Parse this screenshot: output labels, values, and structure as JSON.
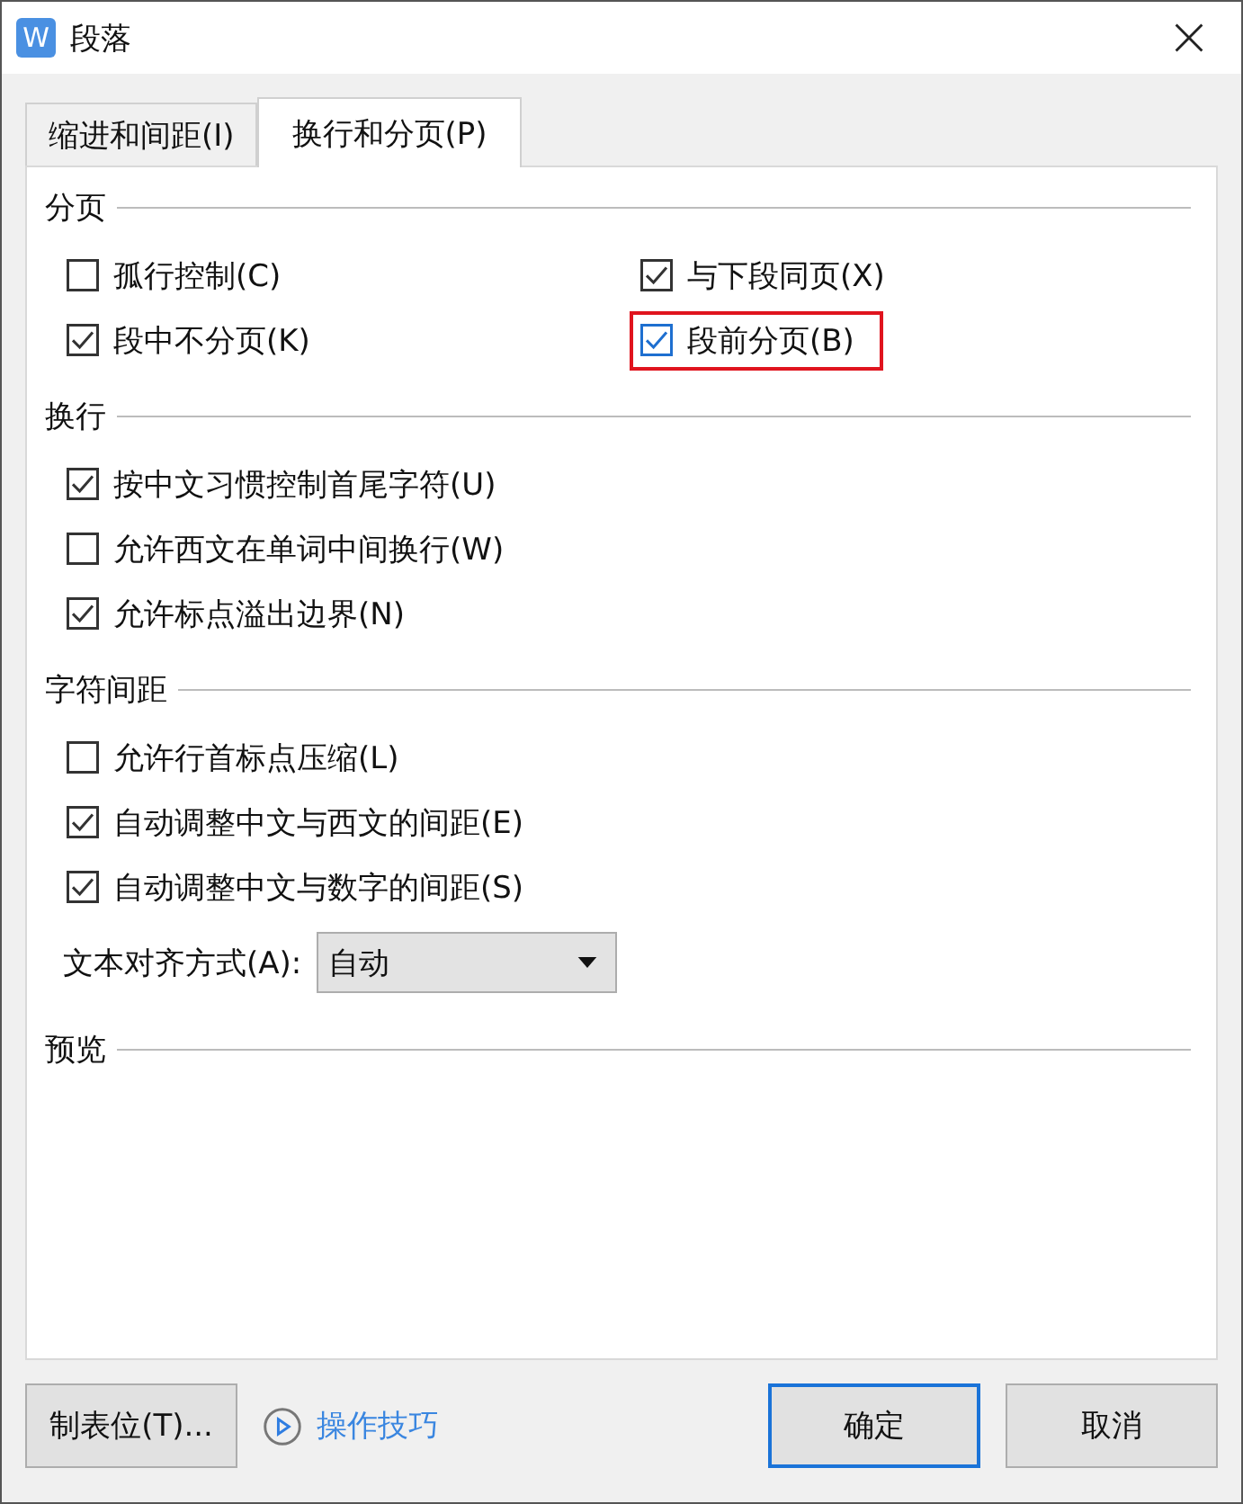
{
  "window": {
    "icon_letter": "W",
    "title": "段落"
  },
  "tabs": [
    {
      "label": "缩进和间距(I)",
      "selected": false
    },
    {
      "label": "换行和分页(P)",
      "selected": true
    }
  ],
  "sections": [
    {
      "title": "分页",
      "kind": "two-column",
      "items": [
        {
          "kind": "checkbox",
          "label": "孤行控制(C)",
          "checked": false,
          "focused": false,
          "highlighted": false
        },
        {
          "kind": "checkbox",
          "label": "与下段同页(X)",
          "checked": true,
          "focused": false,
          "highlighted": false
        },
        {
          "kind": "checkbox",
          "label": "段中不分页(K)",
          "checked": true,
          "focused": false,
          "highlighted": false
        },
        {
          "kind": "checkbox",
          "label": "段前分页(B)",
          "checked": true,
          "focused": true,
          "highlighted": true
        }
      ]
    },
    {
      "title": "换行",
      "kind": "one-column",
      "items": [
        {
          "kind": "checkbox",
          "label": "按中文习惯控制首尾字符(U)",
          "checked": true,
          "focused": false,
          "highlighted": false
        },
        {
          "kind": "checkbox",
          "label": "允许西文在单词中间换行(W)",
          "checked": false,
          "focused": false,
          "highlighted": false
        },
        {
          "kind": "checkbox",
          "label": "允许标点溢出边界(N)",
          "checked": true,
          "focused": false,
          "highlighted": false
        }
      ]
    },
    {
      "title": "字符间距",
      "kind": "one-column",
      "items": [
        {
          "kind": "checkbox",
          "label": "允许行首标点压缩(L)",
          "checked": false,
          "focused": false,
          "highlighted": false
        },
        {
          "kind": "checkbox",
          "label": "自动调整中文与西文的间距(E)",
          "checked": true,
          "focused": false,
          "highlighted": false
        },
        {
          "kind": "checkbox",
          "label": "自动调整中文与数字的间距(S)",
          "checked": true,
          "focused": false,
          "highlighted": false
        },
        {
          "kind": "dropdown",
          "label": "文本对齐方式(A):",
          "value": "自动"
        }
      ]
    },
    {
      "title": "预览"
    }
  ],
  "buttons": {
    "tabs_button": "制表位(T)...",
    "tips_link": "操作技巧",
    "ok": "确定",
    "cancel": "取消"
  }
}
